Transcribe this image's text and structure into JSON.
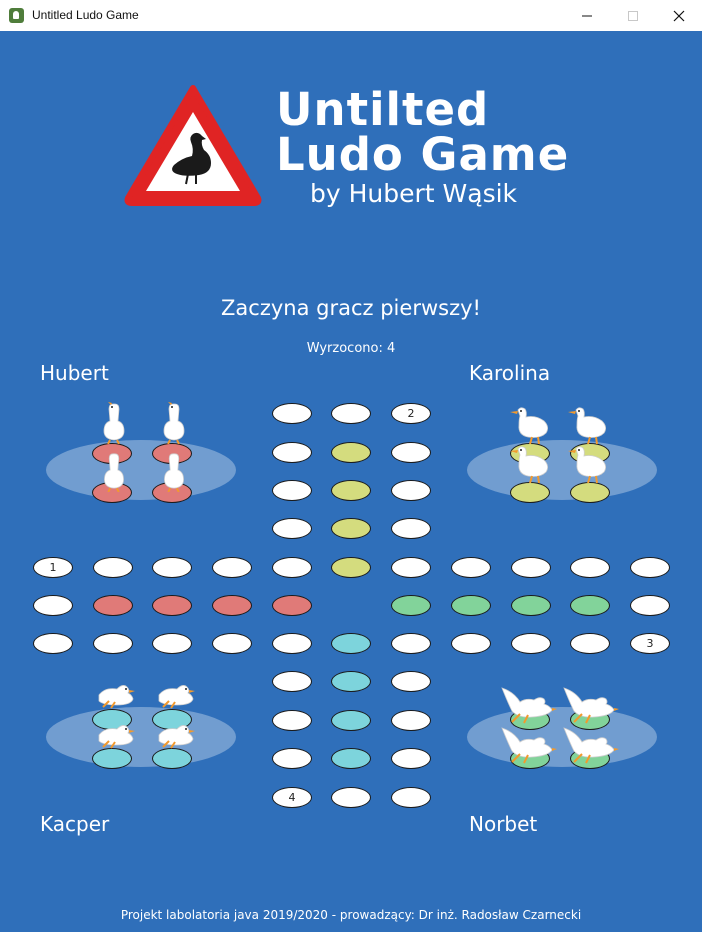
{
  "window": {
    "title": "Untitled Ludo Game"
  },
  "logo": {
    "line1": "Untilted",
    "line2": "Ludo Game",
    "line3": "by Hubert Wąsik"
  },
  "status": {
    "message": "Zaczyna gracz pierwszy!",
    "dice": "Wyrzocono: 4"
  },
  "players": {
    "top_left": "Hubert",
    "top_right": "Karolina",
    "bottom_left": "Kacper",
    "bottom_right": "Norbet"
  },
  "start_labels": {
    "one": "1",
    "two": "2",
    "three": "3",
    "four": "4"
  },
  "colors": {
    "background": "#2f6fba",
    "red": "#e07a78",
    "yellow": "#d4dc7e",
    "green": "#82d39a",
    "cyan": "#7dd4dc"
  },
  "footer": "Projekt labolatoria java 2019/2020 - prowadzący: Dr inż. Radosław Czarnecki"
}
